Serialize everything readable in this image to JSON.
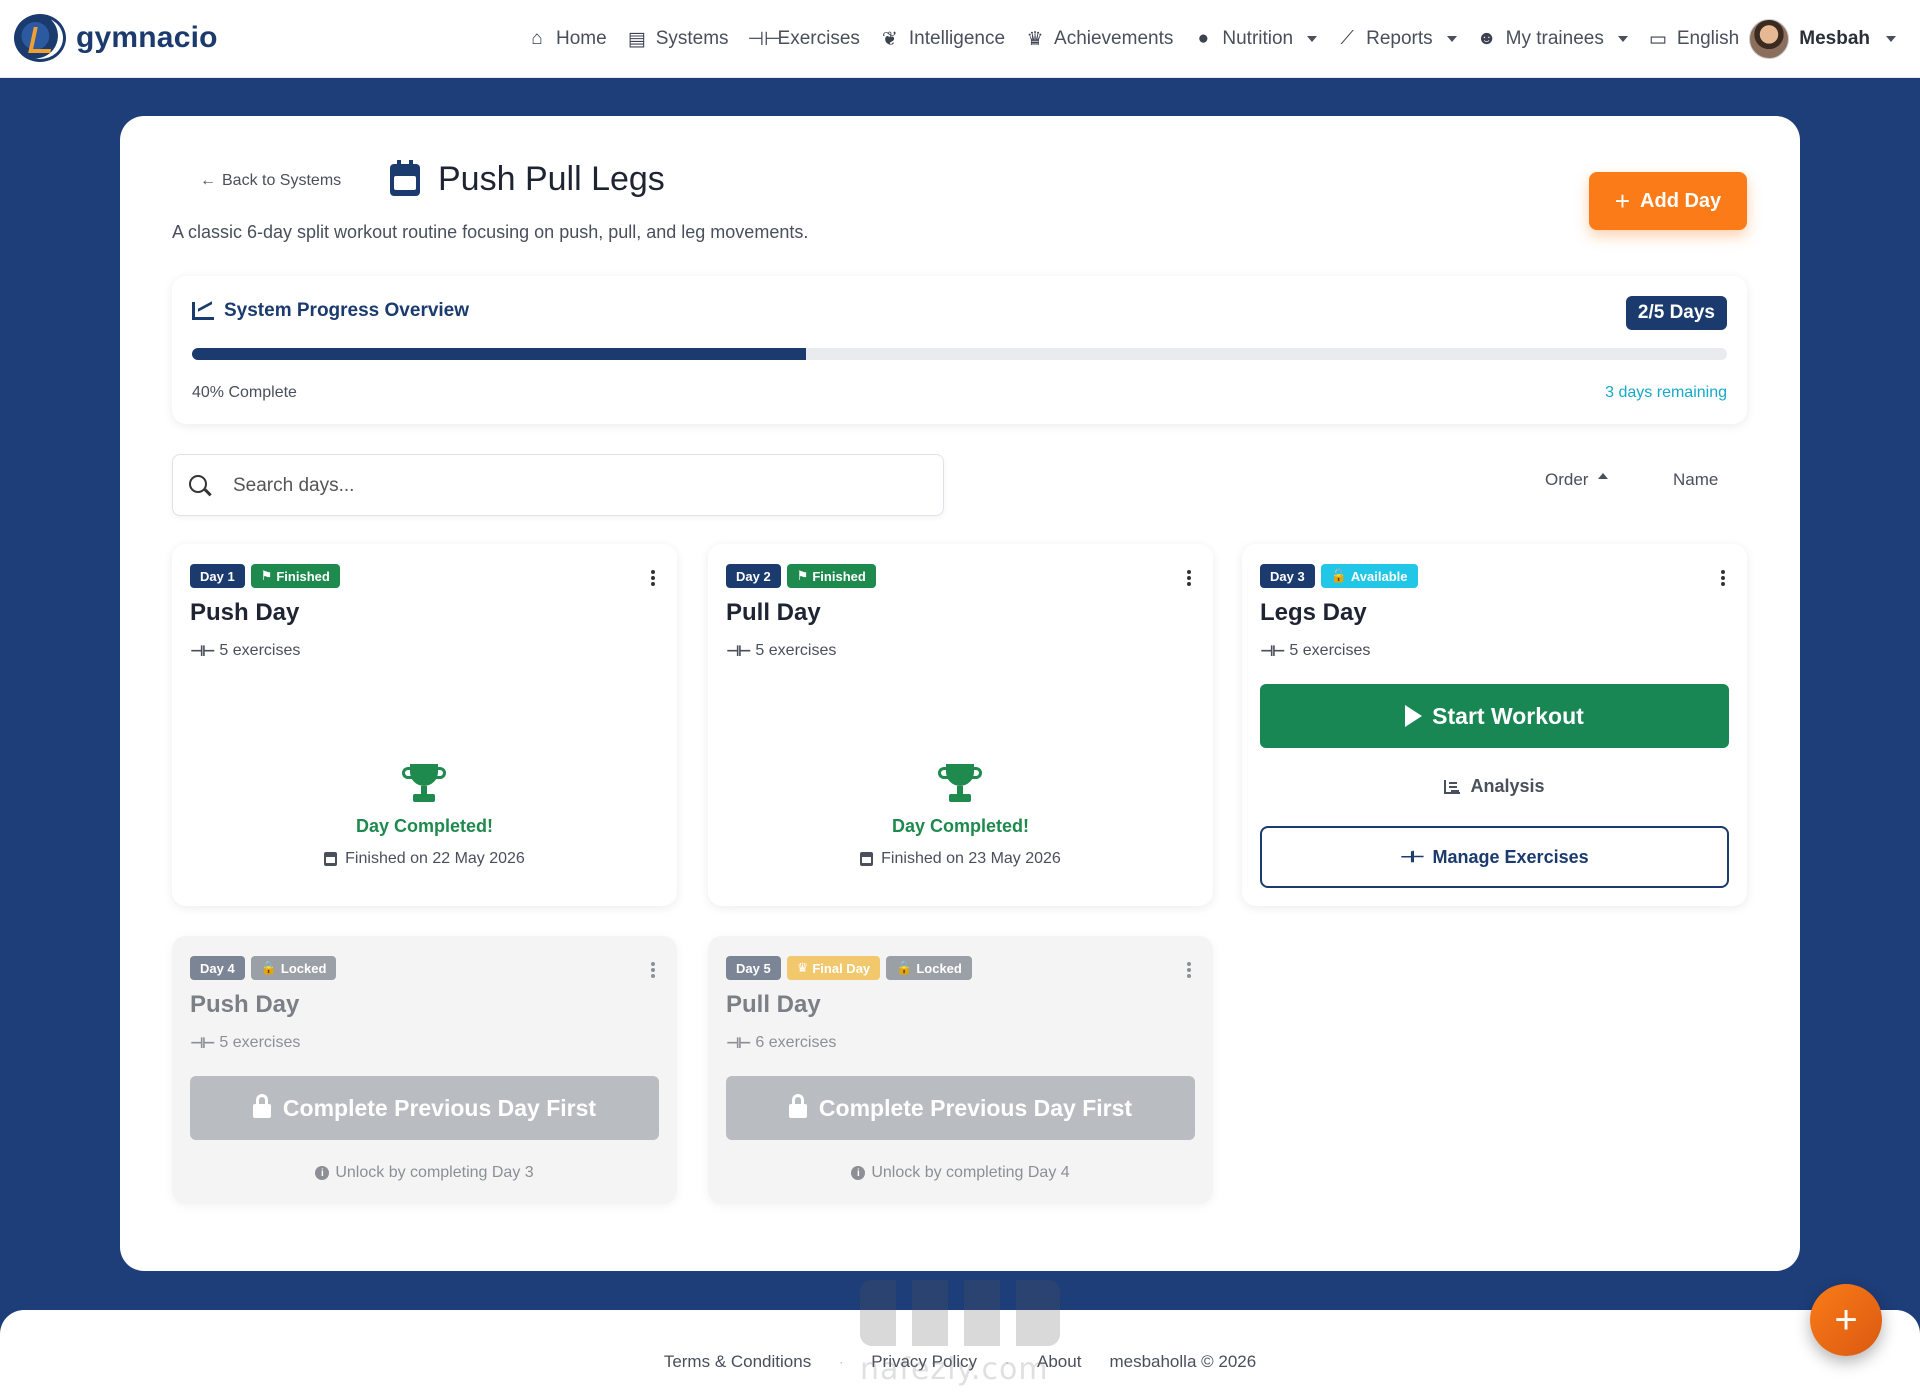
{
  "brand": {
    "name": "gymnacio"
  },
  "nav": {
    "items": [
      {
        "label": "Home",
        "icon": "home-icon",
        "dropdown": false
      },
      {
        "label": "Systems",
        "icon": "clipboard-icon",
        "dropdown": false
      },
      {
        "label": "Exercises",
        "icon": "dumbbell-icon",
        "dropdown": false
      },
      {
        "label": "Intelligence",
        "icon": "brain-icon",
        "dropdown": false
      },
      {
        "label": "Achievements",
        "icon": "trophy-icon",
        "dropdown": false
      },
      {
        "label": "Nutrition",
        "icon": "apple-icon",
        "dropdown": true
      },
      {
        "label": "Reports",
        "icon": "chart-line-icon",
        "dropdown": true
      },
      {
        "label": "My trainees",
        "icon": "users-icon",
        "dropdown": true
      },
      {
        "label": "English",
        "icon": "language-icon",
        "dropdown": true
      }
    ],
    "user": {
      "name": "Mesbah"
    }
  },
  "page": {
    "back_label": "Back to Systems",
    "title": "Push Pull Legs",
    "subtitle": "A classic 6-day split workout routine focusing on push, pull, and leg movements.",
    "add_day_label": "Add Day"
  },
  "progress": {
    "title": "System Progress Overview",
    "days_badge": "2/5 Days",
    "percent": 40,
    "complete_label": "40% Complete",
    "remaining_label": "3 days remaining"
  },
  "search": {
    "placeholder": "Search days..."
  },
  "sort": {
    "order_label": "Order",
    "name_label": "Name"
  },
  "days": [
    {
      "day_badge": "Day 1",
      "status_badge": "Finished",
      "name": "Push Day",
      "exercises": "5 exercises",
      "completed_text": "Day Completed!",
      "finished_on": "Finished on 22 May 2026"
    },
    {
      "day_badge": "Day 2",
      "status_badge": "Finished",
      "name": "Pull Day",
      "exercises": "5 exercises",
      "completed_text": "Day Completed!",
      "finished_on": "Finished on 23 May 2026"
    },
    {
      "day_badge": "Day 3",
      "status_badge": "Available",
      "name": "Legs Day",
      "exercises": "5 exercises",
      "start_label": "Start Workout",
      "analysis_label": "Analysis",
      "manage_label": "Manage Exercises"
    },
    {
      "day_badge": "Day 4",
      "status_badge": "Locked",
      "name": "Push Day",
      "exercises": "5 exercises",
      "locked_label": "Complete Previous Day First",
      "unlock_hint": "Unlock by completing Day 3"
    },
    {
      "day_badge": "Day 5",
      "final_badge": "Final Day",
      "status_badge": "Locked",
      "name": "Pull Day",
      "exercises": "6 exercises",
      "locked_label": "Complete Previous Day First",
      "unlock_hint": "Unlock by completing Day 4"
    }
  ],
  "footer": {
    "terms": "Terms & Conditions",
    "privacy": "Privacy Policy",
    "about": "About",
    "copyright": "mesbaholla © 2026"
  },
  "watermark": {
    "arabic": "نفذلي",
    "latin": "nafezly.com"
  },
  "colors": {
    "brand_navy": "#1b3a6e",
    "accent_orange": "#fb7b18",
    "success_green": "#198754",
    "info_cyan": "#22c6e6",
    "page_background": "#1e3e7a"
  }
}
